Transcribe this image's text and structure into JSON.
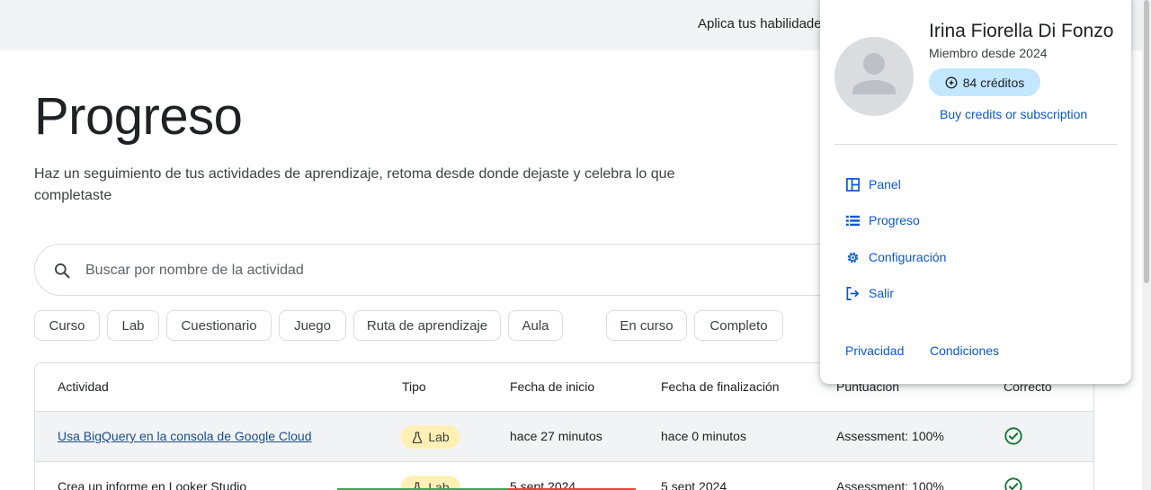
{
  "banner": {
    "text": "Aplica tus habilidades en"
  },
  "page": {
    "title": "Progreso",
    "description": "Haz un seguimiento de tus actividades de aprendizaje, retoma desde donde dejaste y celebra lo que completaste"
  },
  "search": {
    "placeholder": "Buscar por nombre de la actividad",
    "value": ""
  },
  "filters": {
    "type_chips": [
      "Curso",
      "Lab",
      "Cuestionario",
      "Juego",
      "Ruta de aprendizaje",
      "Aula"
    ],
    "status_chips": [
      "En curso",
      "Completo"
    ]
  },
  "table": {
    "headers": {
      "activity": "Actividad",
      "type": "Tipo",
      "start": "Fecha de inicio",
      "end": "Fecha de finalización",
      "score": "Puntuación",
      "correct": "Correcto"
    },
    "rows": [
      {
        "activity": "Usa BigQuery en la consola de Google Cloud",
        "type": "Lab",
        "start": "hace 27 minutos",
        "end": "hace 0 minutos",
        "score": "Assessment: 100%",
        "correct_icon": "check-circle-icon"
      },
      {
        "activity": "Crea un informe en Looker Studio",
        "type": "Lab",
        "start": "5 sept 2024",
        "end": "5 sept 2024",
        "score": "Assessment: 100%",
        "correct_icon": "check-circle-icon"
      }
    ]
  },
  "account": {
    "name": "Irina Fiorella Di Fonzo",
    "member_since": "Miembro desde 2024",
    "credits": "84 créditos",
    "buy_link": "Buy credits or subscription",
    "menu": [
      {
        "label": "Panel",
        "icon": "dashboard-icon"
      },
      {
        "label": "Progreso",
        "icon": "list-icon"
      },
      {
        "label": "Configuración",
        "icon": "gear-icon"
      },
      {
        "label": "Salir",
        "icon": "logout-icon"
      }
    ],
    "footer": {
      "privacy": "Privacidad",
      "terms": "Condiciones"
    }
  },
  "colors": {
    "link": "#0b57d0",
    "credits_bg": "#c2e7ff",
    "lab_badge_bg": "#fef0b4",
    "success": "#137333",
    "banner_bg": "#f1f3f4"
  }
}
